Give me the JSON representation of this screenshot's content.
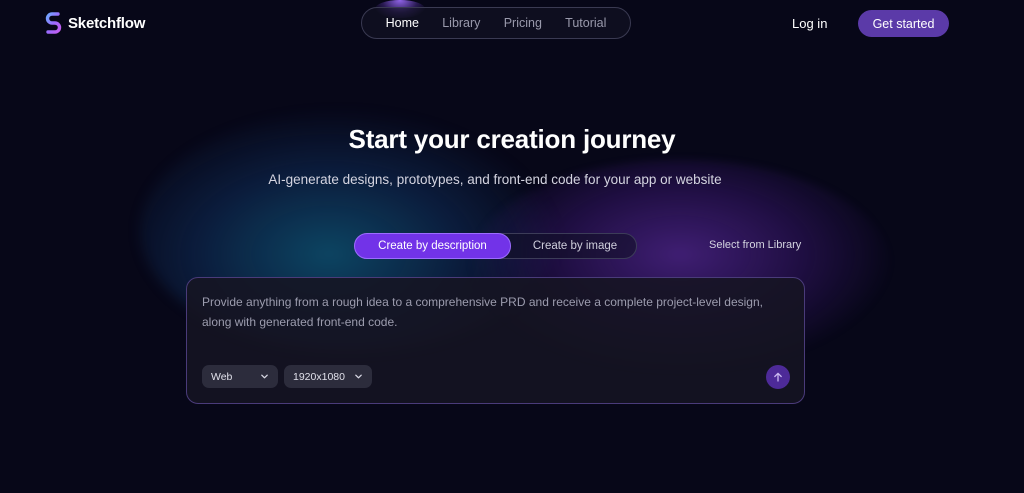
{
  "brand": {
    "name": "Sketchflow",
    "logo_icon": "sketchflow-logo-icon"
  },
  "nav": {
    "items": [
      {
        "label": "Home",
        "active": true
      },
      {
        "label": "Library",
        "active": false
      },
      {
        "label": "Pricing",
        "active": false
      },
      {
        "label": "Tutorial",
        "active": false
      }
    ]
  },
  "header": {
    "login_label": "Log in",
    "get_started_label": "Get started"
  },
  "hero": {
    "title": "Start your creation journey",
    "subtitle": "AI-generate designs, prototypes, and front-end code for your app or website"
  },
  "mode": {
    "tabs": [
      {
        "label": "Create by description",
        "active": true
      },
      {
        "label": "Create by image",
        "active": false
      }
    ],
    "select_library_label": "Select from Library"
  },
  "prompt": {
    "placeholder": "Provide anything from a rough idea to a comprehensive PRD and receive a complete project-level design, along with generated front-end code.",
    "value": "",
    "platform": {
      "selected": "Web"
    },
    "resolution": {
      "selected": "1920x1080"
    },
    "send_icon": "arrow-up-icon"
  },
  "colors": {
    "background": "#070718",
    "accent": "#7233e8",
    "get_started_bg": "#5b3aa8",
    "send_bg": "#4d2a98"
  }
}
